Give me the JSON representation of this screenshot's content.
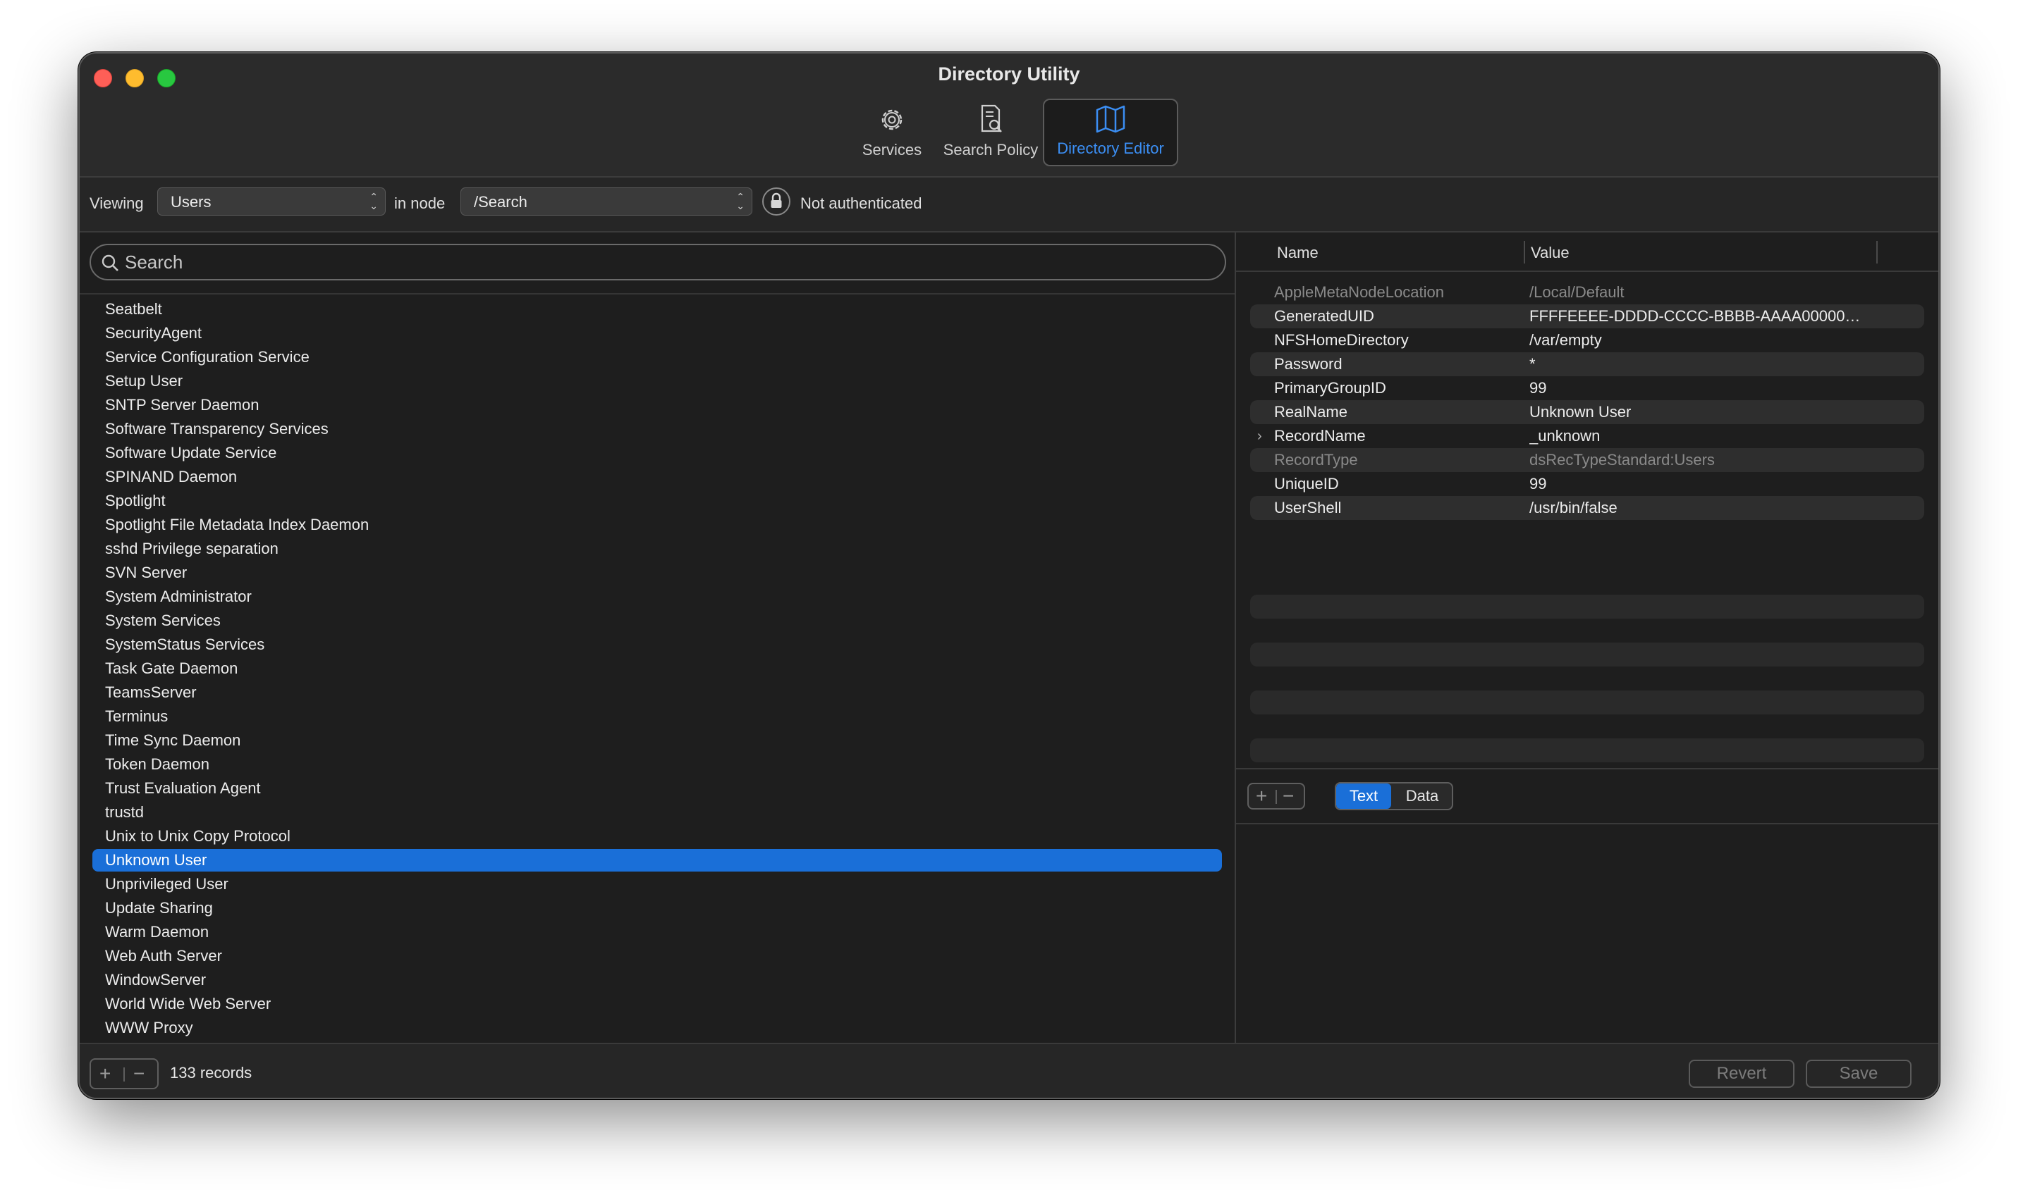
{
  "window": {
    "title": "Directory Utility"
  },
  "toolbar": {
    "services_label": "Services",
    "search_policy_label": "Search Policy",
    "directory_editor_label": "Directory Editor",
    "icons": [
      "gear-icon",
      "search-document-icon",
      "map-icon"
    ],
    "accent": "#3b8ef3"
  },
  "viewing": {
    "viewing_label": "Viewing",
    "record_type": "Users",
    "in_node_label": "in node",
    "node": "/Search",
    "auth_status": "Not authenticated"
  },
  "search": {
    "placeholder": "Search"
  },
  "users": {
    "items": [
      "Seatbelt",
      "SecurityAgent",
      "Service Configuration Service",
      "Setup User",
      "SNTP Server Daemon",
      "Software Transparency Services",
      "Software Update Service",
      "SPINAND Daemon",
      "Spotlight",
      "Spotlight File Metadata Index Daemon",
      "sshd Privilege separation",
      "SVN Server",
      "System Administrator",
      "System Services",
      "SystemStatus Services",
      "Task Gate Daemon",
      "TeamsServer",
      "Terminus",
      "Time Sync Daemon",
      "Token Daemon",
      "Trust Evaluation Agent",
      "trustd",
      "Unix to Unix Copy Protocol",
      "Unknown User",
      "Unprivileged User",
      "Update Sharing",
      "Warm Daemon",
      "Web Auth Server",
      "WindowServer",
      "World Wide Web Server",
      "WWW Proxy"
    ],
    "selected": "Unknown User",
    "selection_color": "#1a6fd8"
  },
  "attributes": {
    "name_header": "Name",
    "value_header": "Value",
    "rows": [
      {
        "name": "AppleMetaNodeLocation",
        "value": "/Local/Default",
        "dim": true
      },
      {
        "name": "GeneratedUID",
        "value": "FFFFEEEE-DDDD-CCCC-BBBB-AAAA00000…",
        "dim": false
      },
      {
        "name": "NFSHomeDirectory",
        "value": "/var/empty",
        "dim": false
      },
      {
        "name": "Password",
        "value": "*",
        "dim": false
      },
      {
        "name": "PrimaryGroupID",
        "value": "99",
        "dim": false
      },
      {
        "name": "RealName",
        "value": "Unknown User",
        "dim": false
      },
      {
        "name": "RecordName",
        "value": "_unknown",
        "dim": false,
        "expandable": true
      },
      {
        "name": "RecordType",
        "value": "dsRecTypeStandard:Users",
        "dim": true
      },
      {
        "name": "UniqueID",
        "value": "99",
        "dim": false
      },
      {
        "name": "UserShell",
        "value": "/usr/bin/false",
        "dim": false
      }
    ]
  },
  "value_format": {
    "text_label": "Text",
    "data_label": "Data",
    "selected": "Text"
  },
  "footer": {
    "add_symbol": "+",
    "remove_symbol": "−",
    "records_count": "133 records",
    "revert_label": "Revert",
    "save_label": "Save"
  }
}
